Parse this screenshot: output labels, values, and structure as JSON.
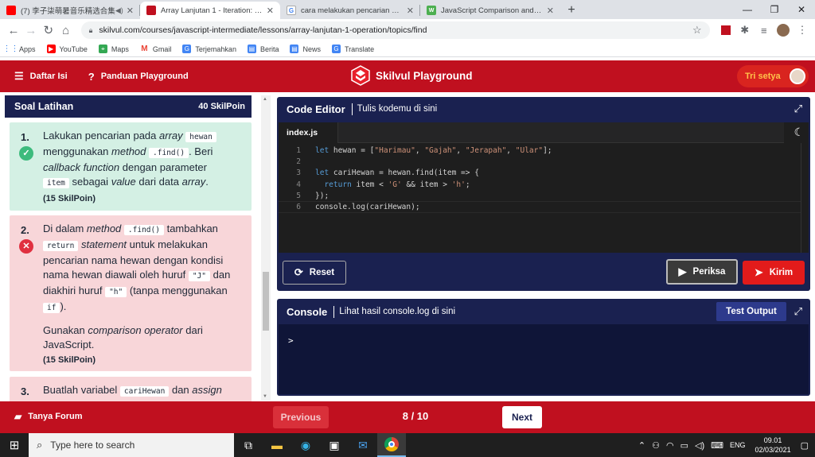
{
  "browser": {
    "tabs": [
      {
        "label": "(7) 李子柒萌暑音乐精选合集",
        "icon": "youtube-icon",
        "active": false
      },
      {
        "label": "Array Lanjutan 1 - Iteration: .find",
        "icon": "skilvul-icon",
        "active": true
      },
      {
        "label": "cara melakukan pencarian nama",
        "icon": "google-icon",
        "active": false
      },
      {
        "label": "JavaScript Comparison and Logic",
        "icon": "w3schools-icon",
        "active": false
      }
    ],
    "new_tab": "+",
    "window_controls": {
      "minimize": "—",
      "maximize": "❐",
      "close": "✕"
    },
    "url": "skilvul.com/courses/javascript-intermediate/lessons/array-lanjutan-1-operation/topics/find",
    "bookmarks": [
      "Apps",
      "YouTube",
      "Maps",
      "Gmail",
      "Terjemahkan",
      "Berita",
      "News",
      "Translate"
    ]
  },
  "header": {
    "menu_label": "Daftar Isi",
    "guide_label": "Panduan Playground",
    "brand": "Skilvul Playground",
    "user_name": "Tri setya",
    "accent": "#c0101f"
  },
  "soal": {
    "title": "Soal Latihan",
    "points": "40 SkilPoin",
    "tasks": [
      {
        "num": "1.",
        "status": "correct",
        "p1": "Lakukan pencarian pada",
        "p1_em": "array",
        "p1_code": "hewan",
        "p2": "menggunakan",
        "p2_em": "method",
        "p2_code": ".find()",
        "p2_tail": ". Beri",
        "p3_em": "callback function",
        "p3": "dengan parameter",
        "p4_code": "item",
        "p4": "sebagai",
        "p4_em": "value",
        "p4b": "dari data",
        "p4_em2": "array",
        "p4_tail": ".",
        "points": "(15 SkilPoin)"
      },
      {
        "num": "2.",
        "status": "wrong",
        "p1": "Di dalam",
        "p1_em": "method",
        "p1_code": ".find()",
        "p1_tail": "tambahkan",
        "p2_code": "return",
        "p2_em": "statement",
        "p2": "untuk melakukan",
        "p3": "pencarian nama hewan dengan kondisi",
        "p4": "nama hewan diawali oleh huruf",
        "p4_code": "\"J\"",
        "p4_tail": "dan",
        "p5": "diakhiri huruf",
        "p5_code": "\"h\"",
        "p5_tail": "(tanpa menggunakan",
        "p6_code": "if",
        "p6_tail": ").",
        "p7": "Gunakan",
        "p7_em": "comparison operator",
        "p7_tail": "dari",
        "p8": "JavaScript.",
        "points": "(15 SkilPoin)"
      },
      {
        "num": "3.",
        "status": "wrong",
        "p1": "Buatlah variabel",
        "p1_code": "cariHewan",
        "p1_tail": "dan",
        "p1_em": "assign"
      }
    ]
  },
  "editor": {
    "title": "Code Editor",
    "subtitle": "Tulis kodemu di sini",
    "file_tab": "index.js",
    "lines": [
      {
        "n": "1",
        "code": "let hewan = [\"Harimau\", \"Gajah\", \"Jerapah\", \"Ular\"];"
      },
      {
        "n": "2",
        "code": ""
      },
      {
        "n": "3",
        "code": "let cariHewan = hewan.find(item => {"
      },
      {
        "n": "4",
        "code": "  return item < 'G' && item > 'h';"
      },
      {
        "n": "5",
        "code": "});"
      },
      {
        "n": "6",
        "code": "console.log(cariHewan);"
      }
    ],
    "reset_label": "Reset",
    "check_label": "Periksa",
    "submit_label": "Kirim"
  },
  "console": {
    "title": "Console",
    "subtitle": "Lihat hasil console.log di sini",
    "test_output_label": "Test Output",
    "prompt": ">"
  },
  "footer": {
    "forum_label": "Tanya Forum",
    "prev_label": "Previous",
    "page": "8 / 10",
    "next_label": "Next"
  },
  "taskbar": {
    "search_placeholder": "Type here to search",
    "lang": "ENG",
    "time": "09.01",
    "date": "02/03/2021"
  }
}
